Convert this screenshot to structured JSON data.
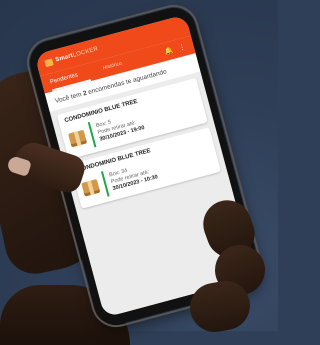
{
  "app": {
    "brand_part1": "Smart",
    "brand_part2": "LOCKER",
    "colors": {
      "primary": "#f04a1b",
      "accent_bar": "#1fa84a"
    }
  },
  "tabs": [
    {
      "label": "Pendentes",
      "active": true
    },
    {
      "label": "Histórico",
      "active": false
    }
  ],
  "toolbar_icons": [
    "bell-icon",
    "more-vert-icon"
  ],
  "message": {
    "prefix": "Você tem ",
    "count": "2",
    "suffix": " encomendas te aguardando"
  },
  "orders": [
    {
      "title": "CONDOMINIO BLUE TREE",
      "box": "Box: 5",
      "pickup_label": "Pode retirar até:",
      "date": "30/10/2023 - 19:00"
    },
    {
      "title": "CONDOMINIO BLUE TREE",
      "box": "Box: 34",
      "pickup_label": "Pode retirar até:",
      "date": "30/10/2023 - 10:30"
    }
  ]
}
